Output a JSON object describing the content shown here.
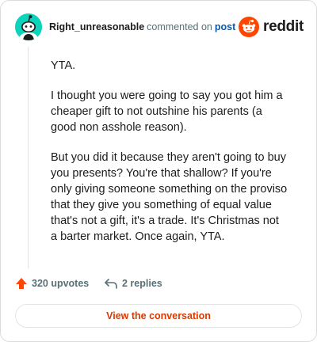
{
  "comment": {
    "author": "Right_unreasonable",
    "action_text": "commented on",
    "post_link": "post",
    "paragraphs": [
      "YTA.",
      "I thought you were going to say you got him a cheaper gift to not outshine his parents (a good non asshole reason).",
      "But you did it because they aren't going to buy you presents? You're that shallow? If you're only giving someone something on the proviso that they give you something of equal value that's not a gift, it's a trade. It's Christmas not a barter market. Once again, YTA."
    ]
  },
  "brand": {
    "wordmark": "reddit",
    "color": "#ff4500"
  },
  "avatar": {
    "icon": "reddit-snoo-avatar-icon",
    "background": "#0dd3bb"
  },
  "actions": {
    "upvotes_label": "320 upvotes",
    "upvote_icon": "upvote-arrow-icon",
    "upvote_color": "#ff4500",
    "replies_label": "2 replies",
    "reply_icon": "reply-arrow-icon"
  },
  "cta": {
    "label": "View the conversation",
    "color": "#d93a00"
  }
}
